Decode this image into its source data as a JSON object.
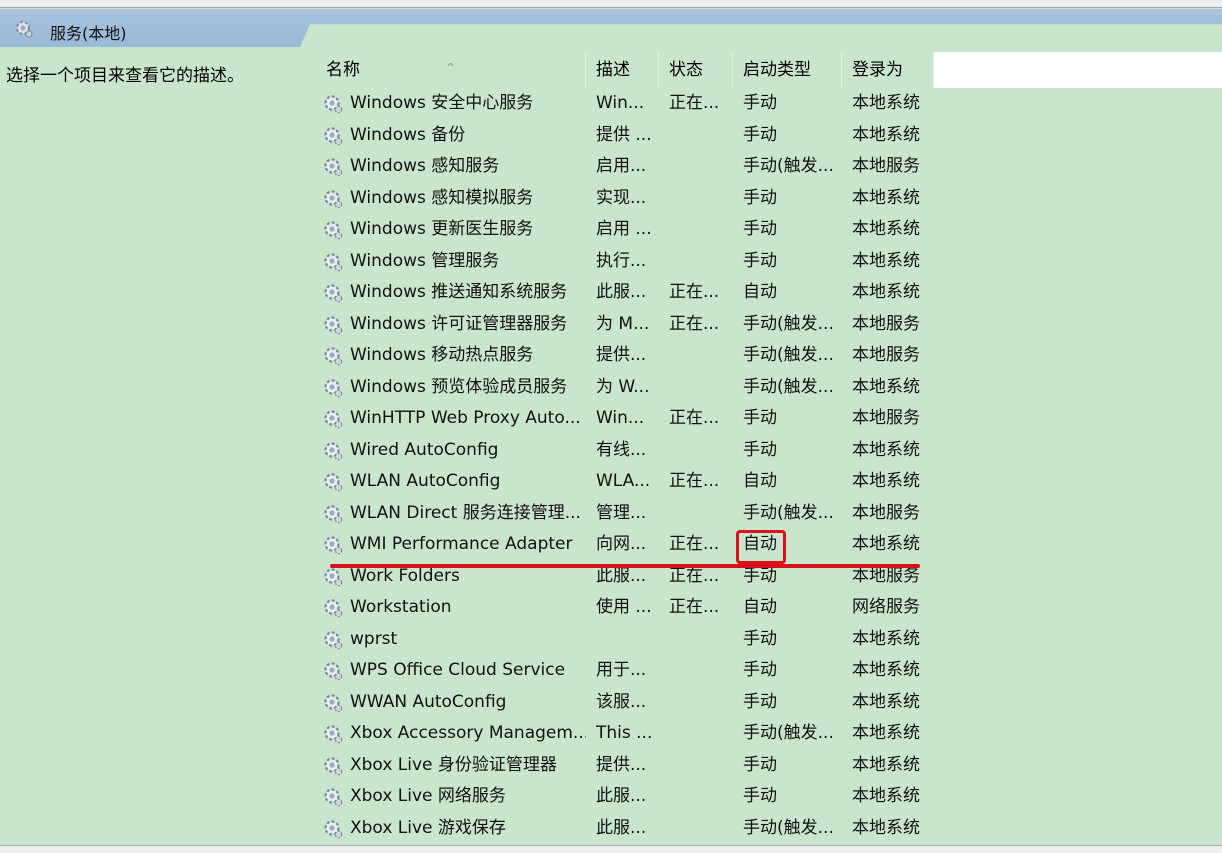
{
  "header": {
    "title": "服务(本地)",
    "icon": "services-gear-icon"
  },
  "left_pane": {
    "description": "选择一个项目来查看它的描述。"
  },
  "columns": {
    "name": "名称",
    "desc": "描述",
    "status": "状态",
    "startup": "启动类型",
    "logon": "登录为"
  },
  "sort_indicator": "^",
  "services": [
    {
      "name": "Windows 安全中心服务",
      "desc": "Win...",
      "status": "正在...",
      "startup": "手动",
      "logon": "本地系统"
    },
    {
      "name": "Windows 备份",
      "desc": "提供 ...",
      "status": "",
      "startup": "手动",
      "logon": "本地系统"
    },
    {
      "name": "Windows 感知服务",
      "desc": "启用...",
      "status": "",
      "startup": "手动(触发...",
      "logon": "本地服务"
    },
    {
      "name": "Windows 感知模拟服务",
      "desc": "实现...",
      "status": "",
      "startup": "手动",
      "logon": "本地系统"
    },
    {
      "name": "Windows 更新医生服务",
      "desc": "启用 ...",
      "status": "",
      "startup": "手动",
      "logon": "本地系统"
    },
    {
      "name": "Windows 管理服务",
      "desc": "执行...",
      "status": "",
      "startup": "手动",
      "logon": "本地系统"
    },
    {
      "name": "Windows 推送通知系统服务",
      "desc": "此服...",
      "status": "正在...",
      "startup": "自动",
      "logon": "本地系统"
    },
    {
      "name": "Windows 许可证管理器服务",
      "desc": "为 M...",
      "status": "正在...",
      "startup": "手动(触发...",
      "logon": "本地服务"
    },
    {
      "name": "Windows 移动热点服务",
      "desc": "提供...",
      "status": "",
      "startup": "手动(触发...",
      "logon": "本地服务"
    },
    {
      "name": "Windows 预览体验成员服务",
      "desc": "为 W...",
      "status": "",
      "startup": "手动(触发...",
      "logon": "本地系统"
    },
    {
      "name": "WinHTTP Web Proxy Auto...",
      "desc": "Win...",
      "status": "正在...",
      "startup": "手动",
      "logon": "本地服务"
    },
    {
      "name": "Wired AutoConfig",
      "desc": "有线...",
      "status": "",
      "startup": "手动",
      "logon": "本地系统"
    },
    {
      "name": "WLAN AutoConfig",
      "desc": "WLA...",
      "status": "正在...",
      "startup": "自动",
      "logon": "本地系统"
    },
    {
      "name": "WLAN Direct 服务连接管理...",
      "desc": "管理...",
      "status": "",
      "startup": "手动(触发...",
      "logon": "本地服务"
    },
    {
      "name": "WMI Performance Adapter",
      "desc": "向网...",
      "status": "正在...",
      "startup": "自动",
      "logon": "本地系统"
    },
    {
      "name": "Work Folders",
      "desc": "此服...",
      "status": "正在...",
      "startup": "手动",
      "logon": "本地服务"
    },
    {
      "name": "Workstation",
      "desc": "使用 ...",
      "status": "正在...",
      "startup": "自动",
      "logon": "网络服务"
    },
    {
      "name": "wprst",
      "desc": "",
      "status": "",
      "startup": "手动",
      "logon": "本地系统"
    },
    {
      "name": "WPS Office Cloud Service",
      "desc": "用于...",
      "status": "",
      "startup": "手动",
      "logon": "本地系统"
    },
    {
      "name": "WWAN AutoConfig",
      "desc": "该服...",
      "status": "",
      "startup": "手动",
      "logon": "本地系统"
    },
    {
      "name": "Xbox Accessory Managem...",
      "desc": "This ...",
      "status": "",
      "startup": "手动(触发...",
      "logon": "本地系统"
    },
    {
      "name": "Xbox Live 身份验证管理器",
      "desc": "提供...",
      "status": "",
      "startup": "手动",
      "logon": "本地系统"
    },
    {
      "name": "Xbox Live 网络服务",
      "desc": "此服...",
      "status": "",
      "startup": "手动",
      "logon": "本地系统"
    },
    {
      "name": "Xbox Live 游戏保存",
      "desc": "此服...",
      "status": "",
      "startup": "手动(触发...",
      "logon": "本地系统"
    }
  ],
  "colors": {
    "background": "#c9e6cc",
    "header_tab": "#a9c3de",
    "annotation": "#d8111b"
  }
}
